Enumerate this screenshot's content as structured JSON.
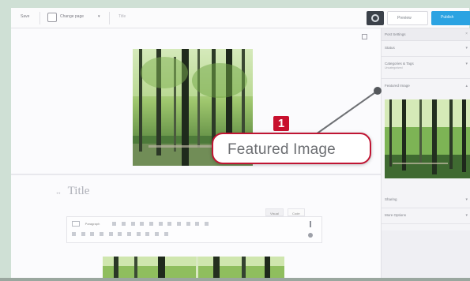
{
  "toolbar": {
    "left_label": "Save",
    "page_label": "Change page",
    "field_text": "Title",
    "preview_label": "Preview",
    "publish_label": "Publish"
  },
  "editor": {
    "title_placeholder": "Title",
    "mode_tabs": [
      "Visual",
      "Code"
    ],
    "block_style": "Paragraph"
  },
  "callout": {
    "number": "1",
    "text": "Featured Image",
    "border_color": "#c01533",
    "badge_color": "#c8102e"
  },
  "sidebar": {
    "header": "Post Settings",
    "rows": [
      {
        "label": "Status",
        "sub": ""
      },
      {
        "label": "Categories & Tags",
        "sub": "Uncategorized"
      },
      {
        "label": "Featured Image",
        "sub": ""
      }
    ],
    "lower_rows": [
      "Sharing",
      "More Options"
    ]
  },
  "colors": {
    "accent": "#2ba3e2",
    "dark": "#3b4149",
    "background": "#cfe0d5"
  },
  "icons": {
    "settings": "gear-icon",
    "toggle": "sidebar-toggle-icon",
    "chevron": "chevron-down-icon"
  }
}
